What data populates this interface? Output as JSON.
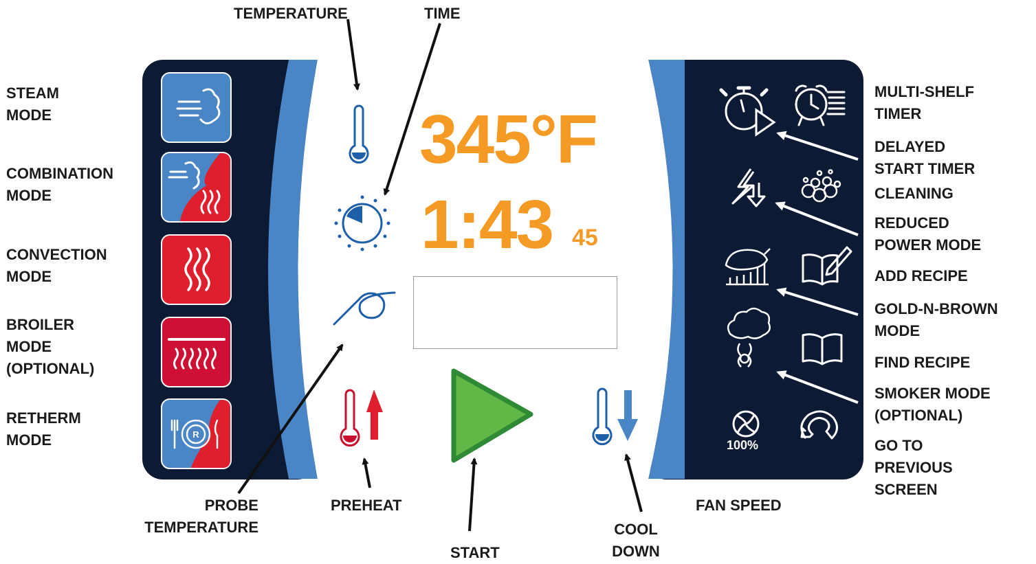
{
  "colors": {
    "panel_navy": "#0c1a33",
    "accent_blue": "#4a86c5",
    "icon_blue": "#1d5fa8",
    "readout_orange": "#f59a24",
    "mode_red": "#e01f2e",
    "broiler_red": "#cf1035",
    "start_green": "#62b846",
    "start_outline": "#2f8a35",
    "preheat_red": "#c8102e"
  },
  "display": {
    "temperature": "345°F",
    "time": "1:43",
    "time_seconds": "45",
    "fan_speed_percent": "100%"
  },
  "labels": {
    "temperature": "TEMPERATURE",
    "time": "TIME",
    "steam_mode": "STEAM\nMODE",
    "combination_mode": "COMBINATION\nMODE",
    "convection_mode": "CONVECTION\nMODE",
    "broiler_mode": "BROILER\nMODE\n(OPTIONAL)",
    "retherm_mode": "RETHERM\nMODE",
    "probe_temperature": "PROBE\nTEMPERATURE",
    "preheat": "PREHEAT",
    "start": "START",
    "cool_down": "COOL\nDOWN",
    "fan_speed": "FAN SPEED",
    "multi_shelf_timer": "MULTI-SHELF\nTIMER",
    "delayed_start_timer": "DELAYED\nSTART TIMER",
    "cleaning": "CLEANING",
    "reduced_power_mode": "REDUCED\nPOWER MODE",
    "add_recipe": "ADD RECIPE",
    "gold_n_brown_mode": "GOLD-N-BROWN\nMODE",
    "find_recipe": "FIND RECIPE",
    "smoker_mode": "SMOKER MODE\n(OPTIONAL)",
    "go_to_previous_screen": "GO TO\nPREVIOUS\nSCREEN"
  },
  "icons": {
    "left_modes": [
      "steam-icon",
      "combination-icon",
      "convection-icon",
      "broiler-icon",
      "retherm-icon"
    ],
    "center": [
      "thermometer-icon",
      "timer-dial-icon",
      "probe-icon",
      "preheat-icon",
      "start-icon",
      "cool-down-icon"
    ],
    "right": [
      "stopwatch-play-icon",
      "alarm-clock-shelves-icon",
      "lightning-down-icon",
      "bubbles-icon",
      "chicken-bars-icon",
      "book-pencil-icon",
      "smoke-cloud-icon",
      "open-book-icon",
      "fan-icon",
      "back-arrow-icon"
    ],
    "retherm_badge": "R"
  }
}
